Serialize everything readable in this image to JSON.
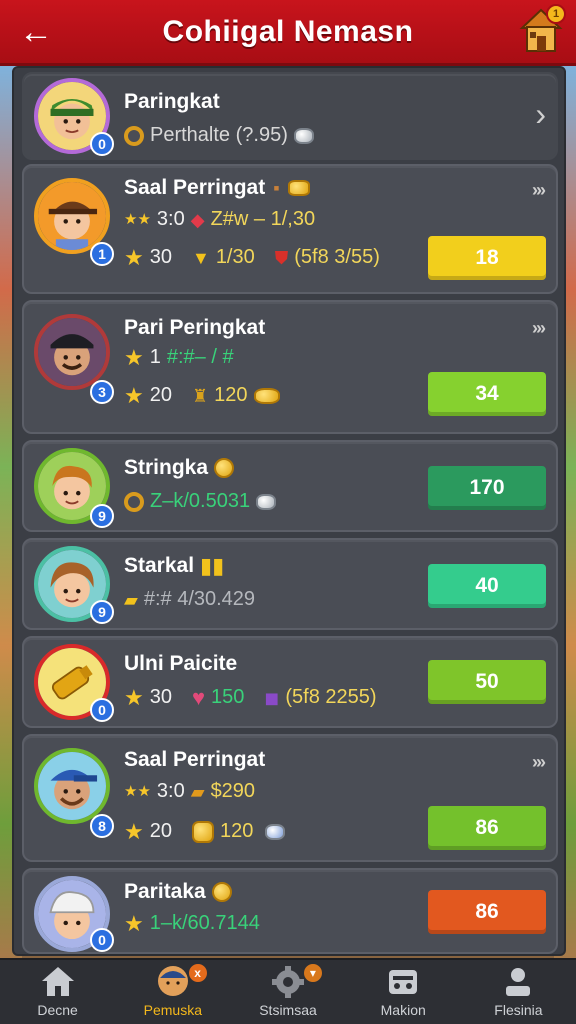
{
  "header": {
    "title": "Cohiigal Nemasn",
    "back_icon": "←",
    "home_badge": "1"
  },
  "top_entry": {
    "name": "Paringkat",
    "rank": "0",
    "stat": "Perthalte (?.95)"
  },
  "entries": [
    {
      "name": "Saal Perringat",
      "rank": "1",
      "line1_star": "3:0",
      "line1_text": "Z#w – 1/,30",
      "line2_a": "30",
      "line2_b": "1/30",
      "line2_c": "(5f8 3/55)",
      "score": "18",
      "score_color": "#f2cf1c",
      "has_chevron": true
    },
    {
      "name": "Pari Peringkat",
      "rank": "3",
      "line1_star": "1",
      "line1_text": "#:#– / #",
      "line2_a": "20",
      "line2_b": "120",
      "score": "34",
      "score_color": "#86d12f",
      "has_chevron": true
    },
    {
      "name": "Stringka",
      "rank": "9",
      "line1_text": "Z–k/0.5031",
      "score": "170",
      "score_color": "#2b9a5e"
    },
    {
      "name": "Starkal",
      "rank": "9",
      "line1_text": "#:# 4/30.429",
      "score": "40",
      "score_color": "#34cc8d"
    },
    {
      "name": "Ulni Paicite",
      "rank": "0",
      "line1_a": "30",
      "line1_b": "150",
      "line1_c": "(5f8 2255)",
      "score": "50",
      "score_color": "#7fc52a"
    },
    {
      "name": "Saal Perringat",
      "rank": "8",
      "line1_star": "3:0",
      "line1_text": "$290",
      "line2_a": "20",
      "line2_b": "120",
      "score": "86",
      "score_color": "#74c12c",
      "has_chevron": true
    },
    {
      "name": "Paritaka",
      "rank": "0",
      "line1_text": "1–k/60.7144",
      "score": "86",
      "score_color": "#e2581f"
    }
  ],
  "nav": [
    {
      "label": "Decne",
      "icon": "home-icon"
    },
    {
      "label": "Pemuska",
      "icon": "profile-avatar-icon",
      "badge": "x",
      "active": true
    },
    {
      "label": "Stsimsaa",
      "icon": "gear-icon",
      "badge": "▾"
    },
    {
      "label": "Makion",
      "icon": "shop-icon"
    },
    {
      "label": "Flesinia",
      "icon": "person-icon"
    }
  ],
  "colors": {
    "header_red": "#c8141c",
    "panel_dark": "#3b3e45",
    "accent_gold": "#f4b81c",
    "green_text": "#39d27a"
  }
}
